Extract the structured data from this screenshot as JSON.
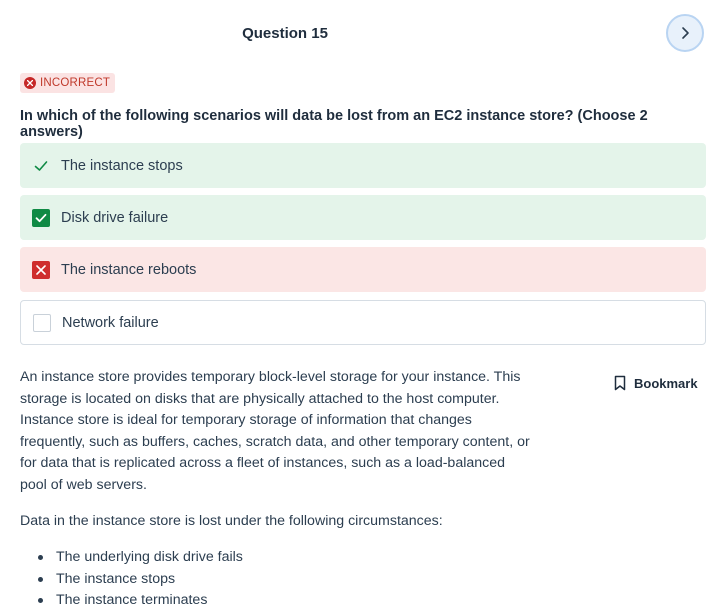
{
  "header": {
    "question_title": "Question 15",
    "next_icon": "chevron-right-icon"
  },
  "status": {
    "label": "INCORRECT",
    "icon": "x-circle-icon",
    "color": "#c62828"
  },
  "question": {
    "text": "In which of the following scenarios will data be lost from an EC2 instance store? (Choose 2 answers)"
  },
  "options": [
    {
      "label": "The instance stops",
      "state": "correct-answer-not-selected",
      "icon": "check-icon"
    },
    {
      "label": "Disk drive failure",
      "state": "correct-selected",
      "icon": "checked-box-icon"
    },
    {
      "label": "The instance reboots",
      "state": "incorrect-selected",
      "icon": "crossed-box-icon"
    },
    {
      "label": "Network failure",
      "state": "unselected",
      "icon": "empty-box-icon"
    }
  ],
  "explanation": {
    "paragraph1": "An instance store provides temporary block-level storage for your instance. This storage is located on disks that are physically attached to the host computer. Instance store is ideal for temporary storage of information that changes frequently, such as buffers, caches, scratch data, and other temporary content, or for data that is replicated across a fleet of instances, such as a load-balanced pool of web servers.",
    "paragraph2": "Data in the instance store is lost under the following circumstances:",
    "bullets": [
      "The underlying disk drive fails",
      "The instance stops",
      "The instance terminates"
    ]
  },
  "bookmark": {
    "label": "Bookmark",
    "icon": "bookmark-icon"
  },
  "colors": {
    "correct_bg": "#e4f4ea",
    "wrong_bg": "#fbe6e5",
    "check_green": "#0f8a45",
    "cross_red": "#cf2d2d"
  }
}
